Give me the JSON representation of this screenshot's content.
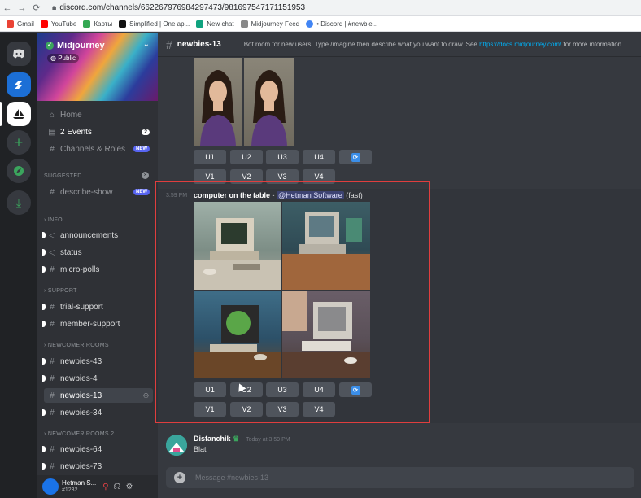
{
  "browser": {
    "url": "discord.com/channels/662267976984297473/981697547171151953",
    "bookmarks": [
      "Gmail",
      "YouTube",
      "Карты",
      "Simplified | One ap...",
      "New chat",
      "Midjourney Feed",
      "• Discord | #newbie..."
    ]
  },
  "server": {
    "name": "Midjourney",
    "public_label": "Public"
  },
  "sidebar": {
    "top_items": [
      {
        "label": "Home"
      },
      {
        "label": "2 Events",
        "badge": "2"
      },
      {
        "label": "Channels & Roles",
        "badge": "NEW"
      }
    ],
    "sections": [
      {
        "title": "SUGGESTED",
        "channels": [
          {
            "name": "describe-show",
            "badge": "NEW"
          }
        ]
      },
      {
        "title": "INFO",
        "channels": [
          {
            "name": "announcements"
          },
          {
            "name": "status"
          },
          {
            "name": "micro-polls"
          }
        ]
      },
      {
        "title": "SUPPORT",
        "channels": [
          {
            "name": "trial-support"
          },
          {
            "name": "member-support"
          }
        ]
      },
      {
        "title": "NEWCOMER ROOMS",
        "channels": [
          {
            "name": "newbies-43"
          },
          {
            "name": "newbies-4"
          },
          {
            "name": "newbies-13"
          },
          {
            "name": "newbies-34"
          }
        ]
      },
      {
        "title": "NEWCOMER ROOMS 2",
        "channels": [
          {
            "name": "newbies-64"
          },
          {
            "name": "newbies-73"
          }
        ]
      }
    ]
  },
  "user": {
    "name": "Hetman S...",
    "tag": "#1232"
  },
  "channel": {
    "name": "newbies-13",
    "topic_prefix": "Bot room for new users. Type /imagine then describe what you want to draw. See",
    "topic_link": "https://docs.midjourney.com/",
    "topic_suffix": "for more information"
  },
  "buttons": {
    "u1": "U1",
    "u2": "U2",
    "u3": "U3",
    "u4": "U4",
    "v1": "V1",
    "v2": "V2",
    "v3": "V3",
    "v4": "V4"
  },
  "message": {
    "time": "3:59 PM",
    "prompt": "computer on the table",
    "separator": "-",
    "mention": "@Hetman Software",
    "mode": "(fast)"
  },
  "reply": {
    "author": "Disfanchik",
    "time": "Today at 3:59 PM",
    "text": "Blat"
  },
  "composer": {
    "placeholder": "Message #newbies-13"
  },
  "colors": {
    "accent": "#5865f2",
    "highlight": "#e03e3e",
    "link": "#00aff4"
  }
}
